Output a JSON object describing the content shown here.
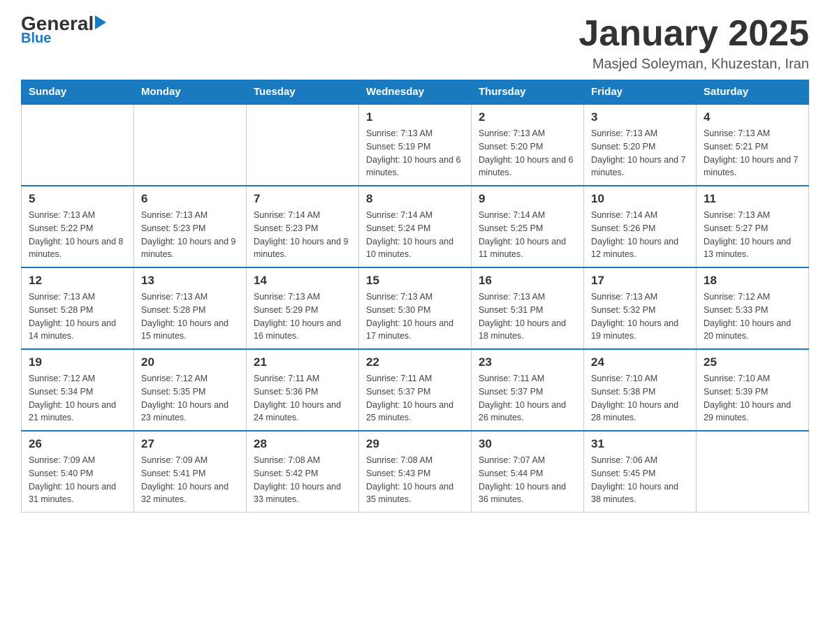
{
  "header": {
    "logo_text": "General",
    "logo_blue_text": "Blue",
    "month_title": "January 2025",
    "location": "Masjed Soleyman, Khuzestan, Iran"
  },
  "weekdays": [
    "Sunday",
    "Monday",
    "Tuesday",
    "Wednesday",
    "Thursday",
    "Friday",
    "Saturday"
  ],
  "weeks": [
    [
      {
        "day": "",
        "sunrise": "",
        "sunset": "",
        "daylight": ""
      },
      {
        "day": "",
        "sunrise": "",
        "sunset": "",
        "daylight": ""
      },
      {
        "day": "",
        "sunrise": "",
        "sunset": "",
        "daylight": ""
      },
      {
        "day": "1",
        "sunrise": "Sunrise: 7:13 AM",
        "sunset": "Sunset: 5:19 PM",
        "daylight": "Daylight: 10 hours and 6 minutes."
      },
      {
        "day": "2",
        "sunrise": "Sunrise: 7:13 AM",
        "sunset": "Sunset: 5:20 PM",
        "daylight": "Daylight: 10 hours and 6 minutes."
      },
      {
        "day": "3",
        "sunrise": "Sunrise: 7:13 AM",
        "sunset": "Sunset: 5:20 PM",
        "daylight": "Daylight: 10 hours and 7 minutes."
      },
      {
        "day": "4",
        "sunrise": "Sunrise: 7:13 AM",
        "sunset": "Sunset: 5:21 PM",
        "daylight": "Daylight: 10 hours and 7 minutes."
      }
    ],
    [
      {
        "day": "5",
        "sunrise": "Sunrise: 7:13 AM",
        "sunset": "Sunset: 5:22 PM",
        "daylight": "Daylight: 10 hours and 8 minutes."
      },
      {
        "day": "6",
        "sunrise": "Sunrise: 7:13 AM",
        "sunset": "Sunset: 5:23 PM",
        "daylight": "Daylight: 10 hours and 9 minutes."
      },
      {
        "day": "7",
        "sunrise": "Sunrise: 7:14 AM",
        "sunset": "Sunset: 5:23 PM",
        "daylight": "Daylight: 10 hours and 9 minutes."
      },
      {
        "day": "8",
        "sunrise": "Sunrise: 7:14 AM",
        "sunset": "Sunset: 5:24 PM",
        "daylight": "Daylight: 10 hours and 10 minutes."
      },
      {
        "day": "9",
        "sunrise": "Sunrise: 7:14 AM",
        "sunset": "Sunset: 5:25 PM",
        "daylight": "Daylight: 10 hours and 11 minutes."
      },
      {
        "day": "10",
        "sunrise": "Sunrise: 7:14 AM",
        "sunset": "Sunset: 5:26 PM",
        "daylight": "Daylight: 10 hours and 12 minutes."
      },
      {
        "day": "11",
        "sunrise": "Sunrise: 7:13 AM",
        "sunset": "Sunset: 5:27 PM",
        "daylight": "Daylight: 10 hours and 13 minutes."
      }
    ],
    [
      {
        "day": "12",
        "sunrise": "Sunrise: 7:13 AM",
        "sunset": "Sunset: 5:28 PM",
        "daylight": "Daylight: 10 hours and 14 minutes."
      },
      {
        "day": "13",
        "sunrise": "Sunrise: 7:13 AM",
        "sunset": "Sunset: 5:28 PM",
        "daylight": "Daylight: 10 hours and 15 minutes."
      },
      {
        "day": "14",
        "sunrise": "Sunrise: 7:13 AM",
        "sunset": "Sunset: 5:29 PM",
        "daylight": "Daylight: 10 hours and 16 minutes."
      },
      {
        "day": "15",
        "sunrise": "Sunrise: 7:13 AM",
        "sunset": "Sunset: 5:30 PM",
        "daylight": "Daylight: 10 hours and 17 minutes."
      },
      {
        "day": "16",
        "sunrise": "Sunrise: 7:13 AM",
        "sunset": "Sunset: 5:31 PM",
        "daylight": "Daylight: 10 hours and 18 minutes."
      },
      {
        "day": "17",
        "sunrise": "Sunrise: 7:13 AM",
        "sunset": "Sunset: 5:32 PM",
        "daylight": "Daylight: 10 hours and 19 minutes."
      },
      {
        "day": "18",
        "sunrise": "Sunrise: 7:12 AM",
        "sunset": "Sunset: 5:33 PM",
        "daylight": "Daylight: 10 hours and 20 minutes."
      }
    ],
    [
      {
        "day": "19",
        "sunrise": "Sunrise: 7:12 AM",
        "sunset": "Sunset: 5:34 PM",
        "daylight": "Daylight: 10 hours and 21 minutes."
      },
      {
        "day": "20",
        "sunrise": "Sunrise: 7:12 AM",
        "sunset": "Sunset: 5:35 PM",
        "daylight": "Daylight: 10 hours and 23 minutes."
      },
      {
        "day": "21",
        "sunrise": "Sunrise: 7:11 AM",
        "sunset": "Sunset: 5:36 PM",
        "daylight": "Daylight: 10 hours and 24 minutes."
      },
      {
        "day": "22",
        "sunrise": "Sunrise: 7:11 AM",
        "sunset": "Sunset: 5:37 PM",
        "daylight": "Daylight: 10 hours and 25 minutes."
      },
      {
        "day": "23",
        "sunrise": "Sunrise: 7:11 AM",
        "sunset": "Sunset: 5:37 PM",
        "daylight": "Daylight: 10 hours and 26 minutes."
      },
      {
        "day": "24",
        "sunrise": "Sunrise: 7:10 AM",
        "sunset": "Sunset: 5:38 PM",
        "daylight": "Daylight: 10 hours and 28 minutes."
      },
      {
        "day": "25",
        "sunrise": "Sunrise: 7:10 AM",
        "sunset": "Sunset: 5:39 PM",
        "daylight": "Daylight: 10 hours and 29 minutes."
      }
    ],
    [
      {
        "day": "26",
        "sunrise": "Sunrise: 7:09 AM",
        "sunset": "Sunset: 5:40 PM",
        "daylight": "Daylight: 10 hours and 31 minutes."
      },
      {
        "day": "27",
        "sunrise": "Sunrise: 7:09 AM",
        "sunset": "Sunset: 5:41 PM",
        "daylight": "Daylight: 10 hours and 32 minutes."
      },
      {
        "day": "28",
        "sunrise": "Sunrise: 7:08 AM",
        "sunset": "Sunset: 5:42 PM",
        "daylight": "Daylight: 10 hours and 33 minutes."
      },
      {
        "day": "29",
        "sunrise": "Sunrise: 7:08 AM",
        "sunset": "Sunset: 5:43 PM",
        "daylight": "Daylight: 10 hours and 35 minutes."
      },
      {
        "day": "30",
        "sunrise": "Sunrise: 7:07 AM",
        "sunset": "Sunset: 5:44 PM",
        "daylight": "Daylight: 10 hours and 36 minutes."
      },
      {
        "day": "31",
        "sunrise": "Sunrise: 7:06 AM",
        "sunset": "Sunset: 5:45 PM",
        "daylight": "Daylight: 10 hours and 38 minutes."
      },
      {
        "day": "",
        "sunrise": "",
        "sunset": "",
        "daylight": ""
      }
    ]
  ]
}
